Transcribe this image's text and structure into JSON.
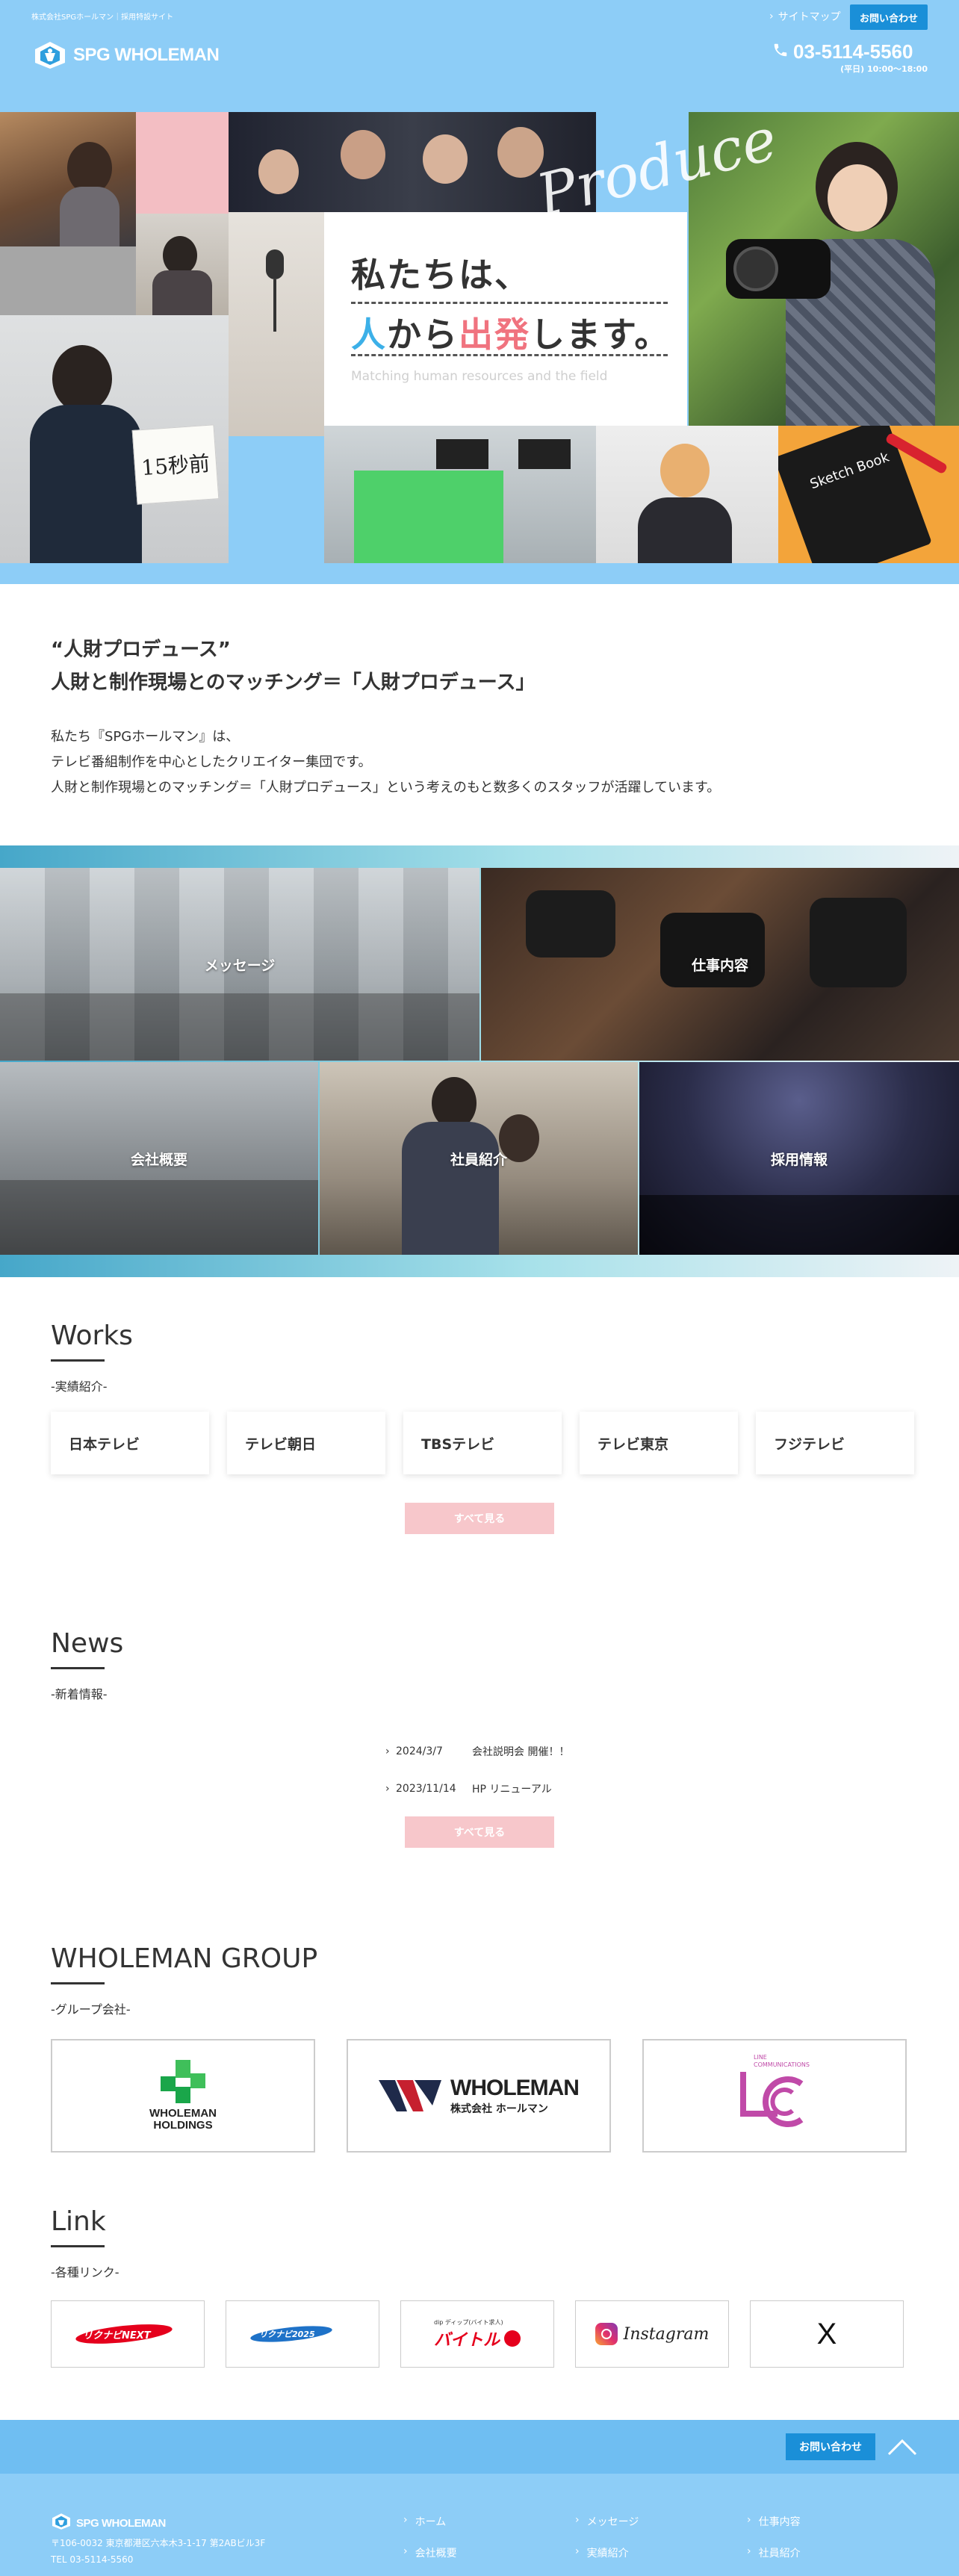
{
  "header": {
    "tagline": "株式会社SPGホールマン｜採用特設サイト",
    "logo_text": "SPG WHOLEMAN",
    "sitemap_label": "サイトマップ",
    "contact_label": "お問い合わせ",
    "phone": "03-5114-5560",
    "hours": "(平日) 10:00〜18:00"
  },
  "hero": {
    "title_line1": "私たちは、",
    "title_line2_part1": "人",
    "title_line2_part2": "から",
    "title_line2_part3": "出発",
    "title_line2_part4": "します。",
    "subtitle": "Matching human resources and the field",
    "script_word": "Produce",
    "sign_text": "15秒前",
    "notebook_text": "Sketch Book"
  },
  "intro": {
    "heading_line1": "“人財プロデュース”",
    "heading_line2": "人財と制作現場とのマッチング＝「人財プロデュース」",
    "body_line1": "私たち『SPGホールマン』は、",
    "body_line2": "テレビ番組制作を中心としたクリエイター集団です。",
    "body_line3": "人財と制作現場とのマッチング＝「人財プロデュース」という考えのもと数多くのスタッフが活躍しています。"
  },
  "nav": {
    "message": "メッセージ",
    "work": "仕事内容",
    "company": "会社概要",
    "staff": "社員紹介",
    "recruit": "採用情報"
  },
  "works": {
    "heading": "Works",
    "sub": "-実績紹介-",
    "items": [
      "日本テレビ",
      "テレビ朝日",
      "TBSテレビ",
      "テレビ東京",
      "フジテレビ"
    ],
    "more_label": "すべて見る"
  },
  "news": {
    "heading": "News",
    "sub": "-新着情報-",
    "items": [
      {
        "date": "2024/3/7",
        "title": "会社説明会 開催！！"
      },
      {
        "date": "2023/11/14",
        "title": "HP リニューアル"
      }
    ],
    "more_label": "すべて見る"
  },
  "group": {
    "heading": "WHOLEMAN GROUP",
    "sub": "-グループ会社-",
    "holdings_line1": "WHOLEMAN",
    "holdings_line2": "HOLDINGS",
    "wholeman_name": "WHOLEMAN",
    "wholeman_sub": "株式会社 ホールマン",
    "lc_text1": "LINE",
    "lc_text2": "COMMUNICATIONS"
  },
  "links": {
    "heading": "Link",
    "sub": "-各種リンク-",
    "rikunabi_next": "リクナビNEXT",
    "rikunabi": "リクナビ2025",
    "baitoru_prefix": "dip ディップ(バイト求人)",
    "baitoru": "バイトル",
    "instagram": "Instagram",
    "x": "X"
  },
  "footer": {
    "contact_label": "お問い合わせ",
    "logo_text": "SPG WHOLEMAN",
    "address": "〒106-0032 東京都港区六本木3-1-17 第2ABビル3F",
    "tel": "TEL 03-5114-5560",
    "links": [
      "ホーム",
      "メッセージ",
      "仕事内容",
      "会社概要",
      "実績紹介",
      "社員紹介"
    ]
  },
  "colors": {
    "header_blue": "#8dcdf7",
    "accent_blue": "#1a8fd8",
    "accent_pink": "#f0737f",
    "button_pink": "#f7c7cb"
  }
}
